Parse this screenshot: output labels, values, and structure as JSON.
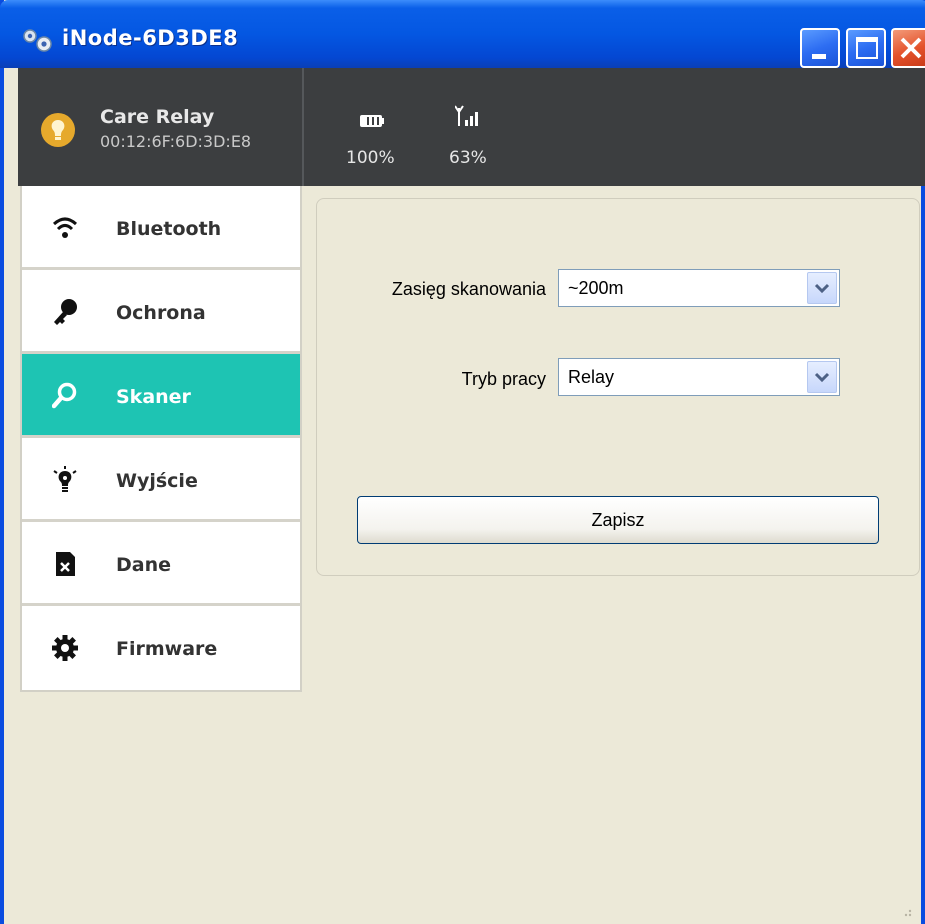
{
  "window": {
    "title": "iNode-6D3DE8",
    "colors": {
      "titlebar": "#0457e2",
      "close": "#e4522b"
    }
  },
  "device": {
    "name": "Care Relay",
    "mac": "00:12:6F:6D:3D:E8",
    "icon": "lightbulb-icon"
  },
  "status": {
    "battery": {
      "label": "100%",
      "level": 100,
      "icon": "battery-icon"
    },
    "signal": {
      "label": "63%",
      "level": 63,
      "icon": "signal-icon"
    }
  },
  "sidebar": {
    "active_color": "#1ec4b3",
    "items": [
      {
        "label": "Bluetooth",
        "icon": "wifi-icon",
        "active": false
      },
      {
        "label": "Ochrona",
        "icon": "key-icon",
        "active": false
      },
      {
        "label": "Skaner",
        "icon": "magnifier-icon",
        "active": true
      },
      {
        "label": "Wyjście",
        "icon": "bulb-icon",
        "active": false
      },
      {
        "label": "Dane",
        "icon": "sd-card-icon",
        "active": false
      },
      {
        "label": "Firmware",
        "icon": "gear-icon",
        "active": false
      }
    ]
  },
  "form": {
    "scan_range": {
      "label": "Zasięg skanowania",
      "value": "~200m"
    },
    "mode": {
      "label": "Tryb pracy",
      "value": "Relay"
    },
    "save_label": "Zapisz"
  }
}
